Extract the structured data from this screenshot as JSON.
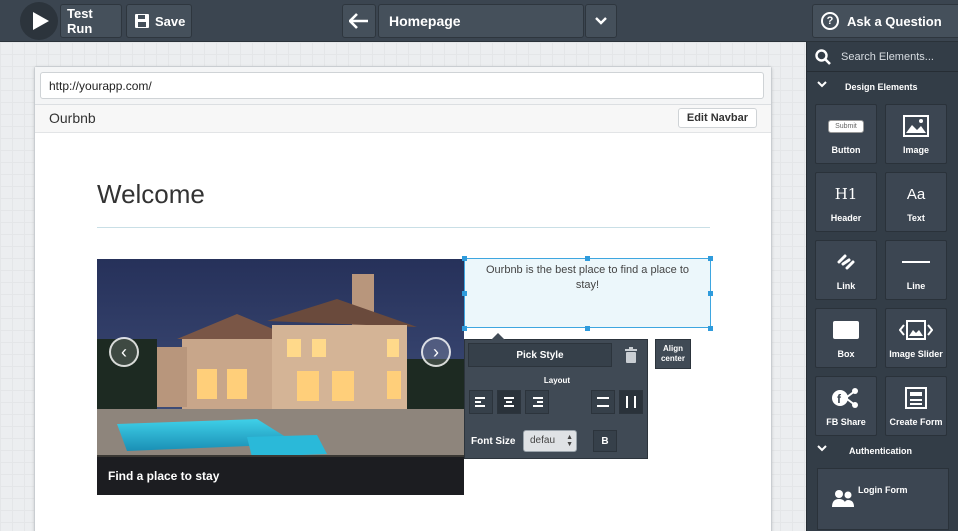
{
  "toolbar": {
    "test_run": "Test Run",
    "save": "Save",
    "page_name": "Homepage",
    "ask": "Ask a Question"
  },
  "sidebar": {
    "search_placeholder": "Search Elements...",
    "design_section": "Design Elements",
    "auth_section": "Authentication",
    "elements": [
      {
        "label": "Button",
        "icon": "button-icon",
        "sample": "Submit"
      },
      {
        "label": "Image",
        "icon": "image-icon"
      },
      {
        "label": "Header",
        "icon": "header-icon",
        "glyph": "H1"
      },
      {
        "label": "Text",
        "icon": "text-icon",
        "glyph": "Aa"
      },
      {
        "label": "Link",
        "icon": "link-icon"
      },
      {
        "label": "Line",
        "icon": "line-icon"
      },
      {
        "label": "Box",
        "icon": "box-icon"
      },
      {
        "label": "Image Slider",
        "icon": "image-slider-icon"
      },
      {
        "label": "FB Share",
        "icon": "fb-share-icon"
      },
      {
        "label": "Create Form",
        "icon": "create-form-icon"
      }
    ],
    "login_form": "Login Form"
  },
  "browser": {
    "url": "http://yourapp.com/",
    "brand": "Ourbnb",
    "edit_navbar": "Edit Navbar"
  },
  "page": {
    "welcome": "Welcome",
    "slider_caption": "Find a place to stay",
    "selected_text": "Ourbnb is the best place to find a place to stay!"
  },
  "style_panel": {
    "pick_style": "Pick Style",
    "layout": "Layout",
    "font_size_label": "Font Size",
    "font_size_value": "defau",
    "bold": "B",
    "align_center": "Align center"
  },
  "colors": {
    "toolbar_bg": "#3b4550",
    "sidebar_bg": "#333d47",
    "selection_blue": "#3ea6e0"
  }
}
